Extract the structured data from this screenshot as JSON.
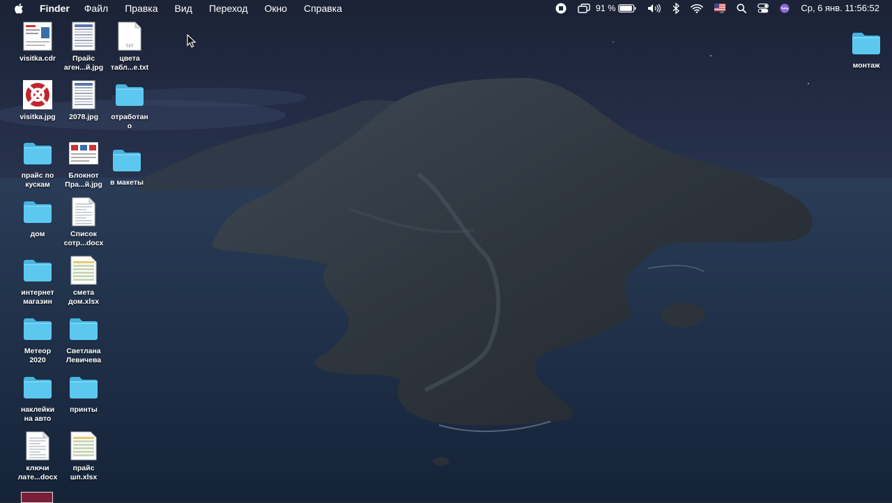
{
  "menubar": {
    "app_name": "Finder",
    "menus": [
      "Файл",
      "Правка",
      "Вид",
      "Переход",
      "Окно",
      "Справка"
    ],
    "battery": "91 %",
    "input_source": "US",
    "clock": "Ср, 6 янв.  11:56:52",
    "icons": [
      "apple-logo-icon",
      "record-stop-icon",
      "screens-icon",
      "battery-icon",
      "volume-icon",
      "bluetooth-icon",
      "wifi-icon",
      "flag-icon",
      "search-icon",
      "control-center-icon",
      "siri-icon"
    ]
  },
  "desktop": {
    "icons": [
      {
        "label": "visitka.cdr",
        "kind": "doc-color"
      },
      {
        "label": "Прайс\nаген...й.jpg",
        "kind": "doc-table"
      },
      {
        "label": "цвета\nтабл...е.txt",
        "kind": "txt",
        "badge": "TXT"
      },
      {
        "label": "visitka.jpg",
        "kind": "logo"
      },
      {
        "label": "2078.jpg",
        "kind": "doc-table"
      },
      {
        "label": "отработан\nо",
        "kind": "folder"
      },
      {
        "label": "прайс по\nкускам",
        "kind": "folder"
      },
      {
        "label": "Блокнот\nПра...й.jpg",
        "kind": "doc-wide"
      },
      {
        "label": "в макеты",
        "kind": "folder"
      },
      {
        "label": "дом",
        "kind": "folder"
      },
      {
        "label": "Список\nсотр...docx",
        "kind": "doc-plain"
      },
      {
        "label": "интернет\nмагазин",
        "kind": "folder"
      },
      {
        "label": "смета\nдом.xlsx",
        "kind": "doc-sheet"
      },
      {
        "label": "Метеор\n2020",
        "kind": "folder"
      },
      {
        "label": "Светлана\nЛевичева",
        "kind": "folder"
      },
      {
        "label": "наклейки\nна авто",
        "kind": "folder"
      },
      {
        "label": "принты",
        "kind": "folder"
      },
      {
        "label": "ключи\nлате...docx",
        "kind": "doc-plain"
      },
      {
        "label": "прайс\nшп.xlsx",
        "kind": "doc-sheet"
      },
      {
        "label": "монтаж",
        "kind": "folder"
      }
    ]
  },
  "colors": {
    "folder_body": "#5cc8f0",
    "folder_tab": "#48b4e0",
    "menubar_bg": "#1c2436",
    "sea": "#1d2d44",
    "sky": "#232f48"
  }
}
